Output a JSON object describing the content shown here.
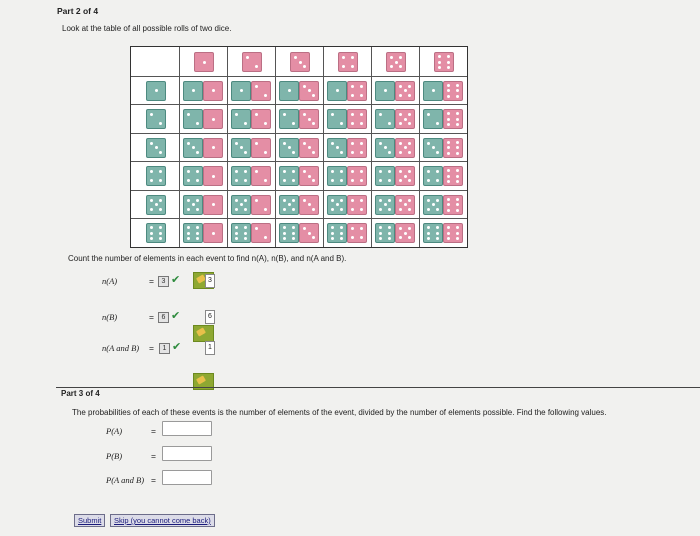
{
  "part2": {
    "title": "Part 2 of 4",
    "instruction": "Look at the table of all possible rolls of two dice.",
    "count_instruction": "Count the number of elements in each event to find n(A), n(B), and n(A and B).",
    "rows": [
      {
        "label": "n(A)",
        "eq": "=",
        "answer": "3",
        "key": "3"
      },
      {
        "label": "n(B)",
        "eq": "=",
        "answer": "6",
        "key": "6"
      },
      {
        "label": "n(A and B)",
        "eq": "=",
        "answer": "1",
        "key": "1"
      }
    ],
    "dice": {
      "header_faces": [
        1,
        2,
        3,
        4,
        5,
        6
      ],
      "row_faces": [
        1,
        2,
        3,
        4,
        5,
        6
      ],
      "row_die_color": "#7fb5ab",
      "col_die_color": "#e48ea5"
    }
  },
  "part3": {
    "title": "Part 3 of 4",
    "instruction": "The probabilities of each of these events is the number of elements of the event, divided by the number of elements possible. Find the following values.",
    "rows": [
      {
        "label": "P(A)",
        "eq": "=",
        "value": "",
        "placeholder": ""
      },
      {
        "label": "P(B)",
        "eq": "=",
        "value": "",
        "placeholder": ""
      },
      {
        "label": "P(A and B)",
        "eq": "=",
        "value": "",
        "placeholder": ""
      }
    ]
  },
  "buttons": {
    "submit": "Submit",
    "skip": "Skip (you cannot come back)"
  },
  "colors": {
    "check": "#2e8b3d",
    "answer_key_bg": "#8ea832"
  }
}
